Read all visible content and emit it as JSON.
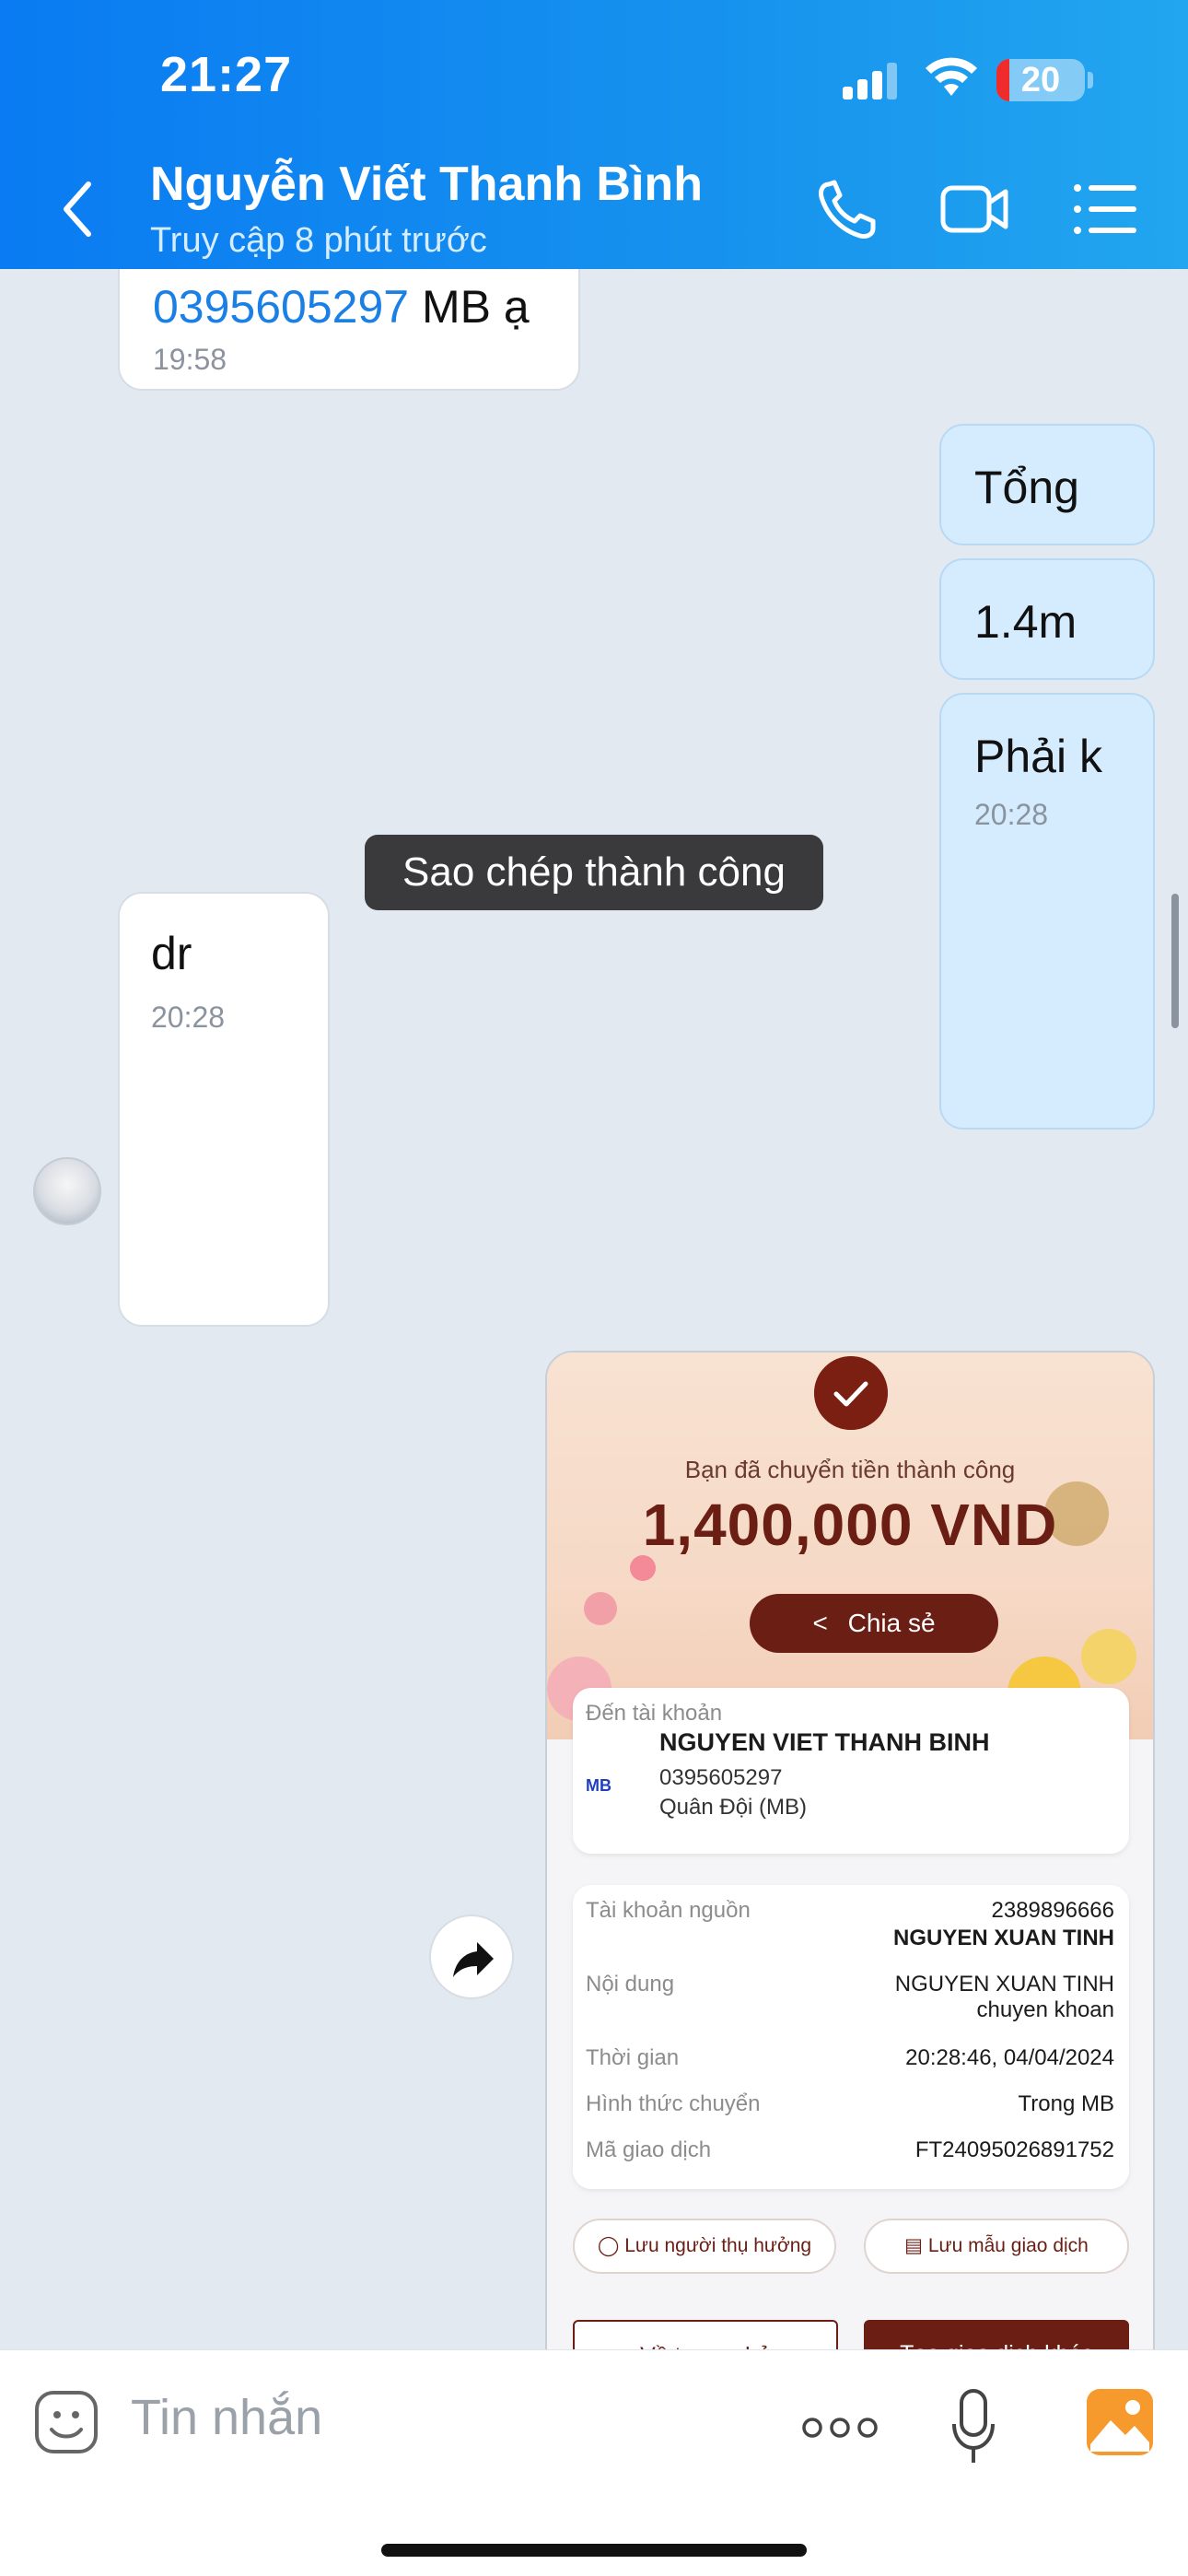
{
  "status_bar": {
    "time": "21:27",
    "battery": "20"
  },
  "header": {
    "contact_name": "Nguyễn Viết Thanh Bình",
    "status": "Truy cập 8 phút trước"
  },
  "messages": [
    {
      "side": "in",
      "text_link": "0395605297",
      "text_rest": " MB ạ",
      "time": "19:58"
    },
    {
      "side": "out",
      "text": "Tổng"
    },
    {
      "side": "out",
      "text": "1.4m"
    },
    {
      "side": "out",
      "text": "Phải k",
      "time": "20:28"
    },
    {
      "side": "in",
      "text": "dr",
      "time": "20:28"
    }
  ],
  "toast": "Sao chép thành công",
  "receipt": {
    "success_message": "Bạn đã chuyển tiền thành công",
    "amount": "1,400,000 VND",
    "share_label": "Chia sẻ",
    "to_account_label": "Đến tài khoản",
    "bank_logo": "MB",
    "recipient_name": "NGUYEN VIET THANH BINH",
    "recipient_account": "0395605297",
    "recipient_bank": "Quân Đội (MB)",
    "details": [
      {
        "label": "Tài khoản nguồn",
        "value": "2389896666",
        "value2": "NGUYEN XUAN TINH"
      },
      {
        "label": "Nội dung",
        "value": "NGUYEN XUAN TINH",
        "value2": "chuyen khoan"
      },
      {
        "label": "Thời gian",
        "value": "20:28:46, 04/04/2024"
      },
      {
        "label": "Hình thức chuyển",
        "value": "Trong MB"
      },
      {
        "label": "Mã giao dịch",
        "value": "FT24095026891752"
      }
    ],
    "save_beneficiary": "Lưu người thụ hưởng",
    "save_template": "Lưu mẫu giao dịch",
    "home_button": "Về trang chủ",
    "new_transaction_button": "Tạo giao dịch khác"
  },
  "input": {
    "placeholder": "Tin nhắn"
  },
  "colors": {
    "header": "#0a7bf2",
    "out_bubble": "#d4ecfe",
    "receipt_brand": "#6a1e14",
    "link": "#1a80e6"
  }
}
